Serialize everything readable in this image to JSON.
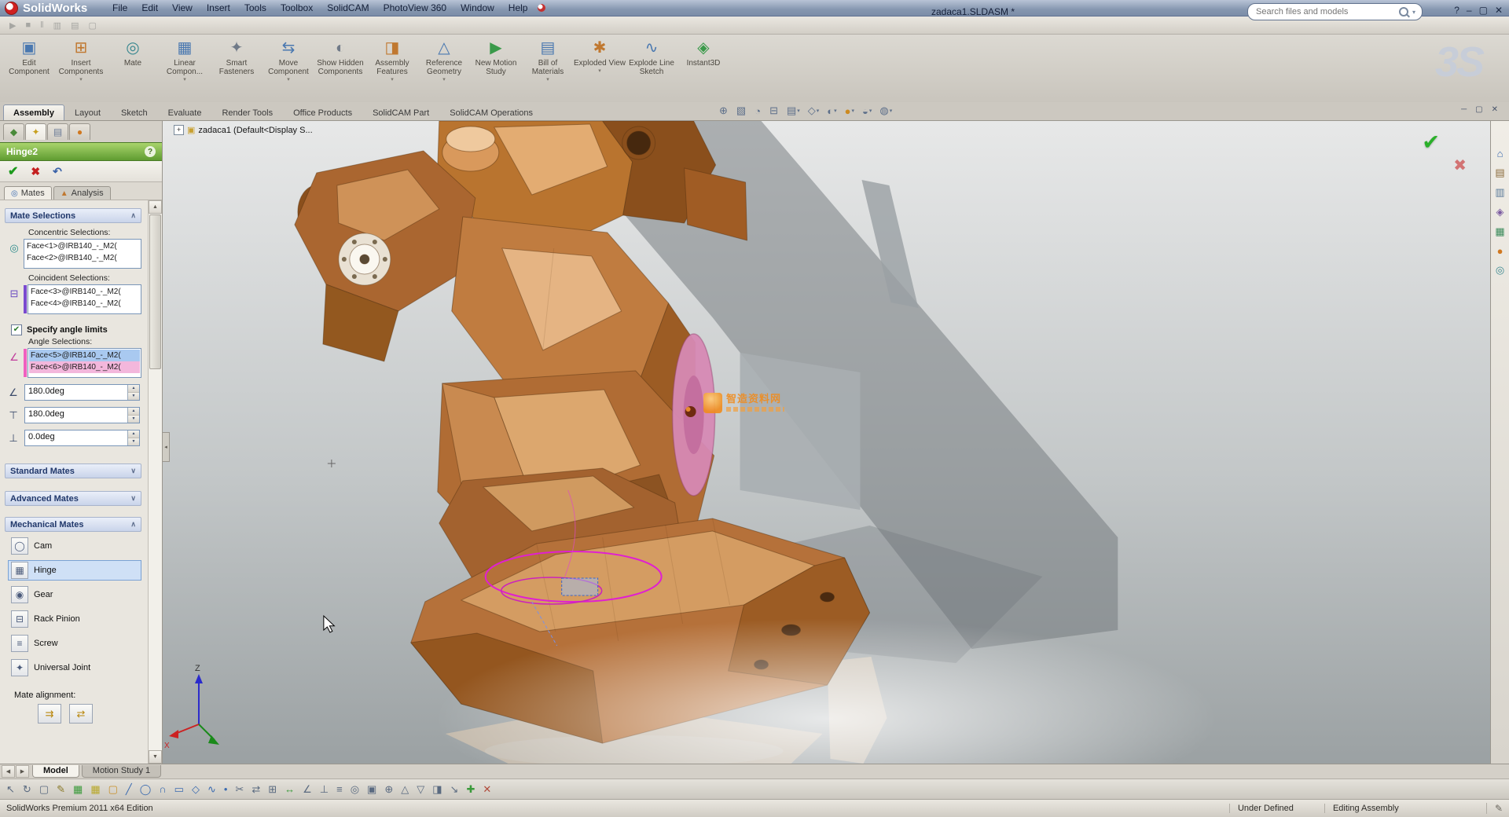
{
  "titlebar": {
    "app": "SolidWorks",
    "doc_title": "zadaca1.SLDASM *",
    "search_placeholder": "Search files and models",
    "help_label": "?",
    "min": "–",
    "max": "▢",
    "close": "✕"
  },
  "menubar": [
    "File",
    "Edit",
    "View",
    "Insert",
    "Tools",
    "Toolbox",
    "SolidCAM",
    "PhotoView 360",
    "Window",
    "Help"
  ],
  "quickbar": {
    "icons": [
      {
        "g": "▶"
      },
      {
        "g": "■"
      },
      {
        "g": "‖"
      },
      {
        "g": "▥"
      },
      {
        "g": "▤"
      },
      {
        "g": "▢"
      }
    ]
  },
  "ds_mark": "3S",
  "command_manager": {
    "buttons": [
      {
        "label": "Edit Component",
        "g": "▣",
        "c": "#4a78b0",
        "caret": ""
      },
      {
        "label": "Insert Components",
        "g": "⊞",
        "c": "#c07830",
        "caret": "▾"
      },
      {
        "label": "Mate",
        "g": "◎",
        "c": "#3a8890",
        "caret": ""
      },
      {
        "label": "Linear Compon...",
        "g": "▦",
        "c": "#4a78b0",
        "caret": "▾"
      },
      {
        "label": "Smart Fasteners",
        "g": "✦",
        "c": "#707a88",
        "caret": ""
      },
      {
        "label": "Move Component",
        "g": "⇆",
        "c": "#4a78b0",
        "caret": "▾"
      },
      {
        "label": "Show Hidden Components",
        "g": "◐",
        "c": "#707a88",
        "caret": ""
      },
      {
        "label": "Assembly Features",
        "g": "◨",
        "c": "#c07830",
        "caret": "▾"
      },
      {
        "label": "Reference Geometry",
        "g": "△",
        "c": "#4a78b0",
        "caret": "▾"
      },
      {
        "label": "New Motion Study",
        "g": "▶",
        "c": "#3a9a4a",
        "caret": ""
      },
      {
        "label": "Bill of Materials",
        "g": "▤",
        "c": "#4a78b0",
        "caret": "▾"
      },
      {
        "label": "Exploded View",
        "g": "✱",
        "c": "#c07830",
        "caret": "▾"
      },
      {
        "label": "Explode Line Sketch",
        "g": "∿",
        "c": "#4a78b0",
        "caret": ""
      },
      {
        "label": "Instant3D",
        "g": "◈",
        "c": "#3a9a4a",
        "caret": ""
      }
    ]
  },
  "ribbon_tabs": [
    {
      "label": "Assembly",
      "cls": "active"
    },
    {
      "label": "Layout"
    },
    {
      "label": "Sketch"
    },
    {
      "label": "Evaluate"
    },
    {
      "label": "Render Tools"
    },
    {
      "label": "Office Products"
    },
    {
      "label": "SolidCAM Part"
    },
    {
      "label": "SolidCAM Operations"
    }
  ],
  "headsup": {
    "icons": [
      {
        "g": "⊕",
        "caret": ""
      },
      {
        "g": "▧",
        "caret": ""
      },
      {
        "g": "◔",
        "caret": ""
      },
      {
        "g": "⊟",
        "caret": ""
      },
      {
        "g": "▤",
        "caret": "▾"
      },
      {
        "g": "◇",
        "caret": "▾"
      },
      {
        "g": "◐",
        "caret": "▾"
      },
      {
        "g": "●",
        "c": "#cc8a20",
        "caret": "▾"
      },
      {
        "g": "◒",
        "caret": "▾"
      },
      {
        "g": "◍",
        "caret": "▾"
      }
    ]
  },
  "docwin": {
    "min": "─",
    "max": "▢",
    "close": "✕"
  },
  "property_manager": {
    "top_tabs": [
      {
        "g": "◆",
        "c": "#4a8a3a"
      },
      {
        "g": "✦",
        "c": "#c8a020",
        "cls": "active"
      },
      {
        "g": "▤",
        "c": "#6a7a96"
      },
      {
        "g": "●",
        "c": "#d07820"
      }
    ],
    "title": "Hinge2",
    "help": "?",
    "tabs": [
      {
        "label": "Mates",
        "g": "◎",
        "c": "#3a6ab0",
        "cls": "active"
      },
      {
        "label": "Analysis",
        "g": "▲",
        "c": "#c07830"
      }
    ],
    "sections": {
      "mate_selections": "Mate Selections",
      "standard": "Standard Mates",
      "advanced": "Advanced Mates",
      "mechanical": "Mechanical Mates"
    },
    "icons": {
      "concentric": "◎",
      "coincident": "⊟",
      "angle": "∠"
    },
    "concentric_label": "Concentric Selections:",
    "concentric_items": [
      {
        "t": "Face<1>@IRB140_-_M2("
      },
      {
        "t": "Face<2>@IRB140_-_M2("
      }
    ],
    "coincident_label": "Coincident Selections:",
    "coincident_items": [
      {
        "t": "Face<3>@IRB140_-_M2("
      },
      {
        "t": "Face<4>@IRB140_-_M2("
      }
    ],
    "specify_angle": "Specify angle limits",
    "angle_label": "Angle Selections:",
    "angle_items": [
      {
        "t": "Face<5>@IRB140_-_M2(",
        "cls": "sel-blue"
      },
      {
        "t": "Face<6>@IRB140_-_M2(",
        "cls": "sel-pink"
      }
    ],
    "angle_fields": [
      {
        "g": "∠",
        "v": "180.0deg"
      },
      {
        "g": "⊤",
        "v": "180.0deg"
      },
      {
        "g": "⊥",
        "v": "0.0deg"
      }
    ],
    "mech_items": [
      {
        "g": "◯",
        "label": "Cam"
      },
      {
        "g": "▦",
        "label": "Hinge",
        "cls": "selected"
      },
      {
        "g": "◉",
        "label": "Gear"
      },
      {
        "g": "⊟",
        "label": "Rack Pinion"
      },
      {
        "g": "≡",
        "label": "Screw"
      },
      {
        "g": "✦",
        "label": "Universal Joint"
      }
    ],
    "alignment_label": "Mate alignment:",
    "alignment_buttons": [
      {
        "g": "⇉"
      },
      {
        "g": "⇄"
      }
    ]
  },
  "viewport": {
    "tree_root": "zadaca1  (Default<Display S...",
    "triad": {
      "x": "X",
      "z": "Z"
    },
    "confirm": {
      "ok": "✔",
      "cancel": "✖"
    },
    "watermark_text": "智造资料网",
    "palette": {
      "copper_dark": "#8a4f1c",
      "copper": "#b5713a",
      "copper_light": "#d9a268",
      "copper_pale": "#efcfa4",
      "highlight_magenta": "#e020d0",
      "selected_face_pink": "#d689b4"
    }
  },
  "taskpane": {
    "icons": [
      {
        "g": "⌂",
        "c": "#3a6ab0"
      },
      {
        "g": "▤",
        "c": "#8a6a3a"
      },
      {
        "g": "▥",
        "c": "#5a7a9a"
      },
      {
        "g": "◈",
        "c": "#7a5aa0"
      },
      {
        "g": "▦",
        "c": "#3a8a5a"
      },
      {
        "g": "●",
        "c": "#d07820"
      },
      {
        "g": "◎",
        "c": "#3a8890"
      }
    ]
  },
  "bottom_nav": [
    {
      "g": "◀"
    },
    {
      "g": "▶"
    }
  ],
  "bottom_tabs": [
    {
      "label": "Model",
      "cls": "active"
    },
    {
      "label": "Motion Study 1"
    }
  ],
  "sketchbar": {
    "icons": [
      {
        "g": "↖",
        "c": "#5a6a80"
      },
      {
        "g": "↻",
        "c": "#5a6a80"
      },
      {
        "g": "▢",
        "c": "#5a6a80"
      },
      {
        "g": "✎",
        "c": "#8a7a2a"
      },
      {
        "g": "▦",
        "c": "#3a9a3a"
      },
      {
        "g": "▦",
        "c": "#b8a82a"
      },
      {
        "g": "▢",
        "c": "#c8902a"
      },
      {
        "g": "╱",
        "c": "#3a6ab0"
      },
      {
        "g": "◯",
        "c": "#3a6ab0"
      },
      {
        "g": "∩",
        "c": "#3a6ab0"
      },
      {
        "g": "▭",
        "c": "#3a6ab0"
      },
      {
        "g": "◇",
        "c": "#3a6ab0"
      },
      {
        "g": "∿",
        "c": "#3a6ab0"
      },
      {
        "g": "•",
        "c": "#3a6ab0"
      },
      {
        "g": "✂",
        "c": "#5a6a80"
      },
      {
        "g": "⇄",
        "c": "#5a6a80"
      },
      {
        "g": "⊞",
        "c": "#5a6a80"
      },
      {
        "g": "↔",
        "c": "#3a9a3a"
      },
      {
        "g": "∠",
        "c": "#5a6a80"
      },
      {
        "g": "⊥",
        "c": "#5a6a80"
      },
      {
        "g": "≡",
        "c": "#5a6a80"
      },
      {
        "g": "◎",
        "c": "#5a6a80"
      },
      {
        "g": "▣",
        "c": "#5a6a80"
      },
      {
        "g": "⊕",
        "c": "#5a6a80"
      },
      {
        "g": "△",
        "c": "#5a6a80"
      },
      {
        "g": "▽",
        "c": "#5a6a80"
      },
      {
        "g": "◨",
        "c": "#5a6a80"
      },
      {
        "g": "↘",
        "c": "#5a6a80"
      },
      {
        "g": "✚",
        "c": "#3a9a3a"
      },
      {
        "g": "✕",
        "c": "#b04a3a"
      }
    ]
  },
  "statusbar": {
    "left": "SolidWorks Premium 2011 x64 Edition",
    "state": "Under Defined",
    "mode": "Editing Assembly",
    "icon": "✎"
  },
  "ui": {
    "chevron_up": "∧",
    "chevron_down": "∨",
    "spinner_up": "▲",
    "spinner_down": "▼",
    "check": "✔",
    "plus": "+",
    "assembly_glyph": "▣",
    "splitter_glyph": "◂"
  }
}
